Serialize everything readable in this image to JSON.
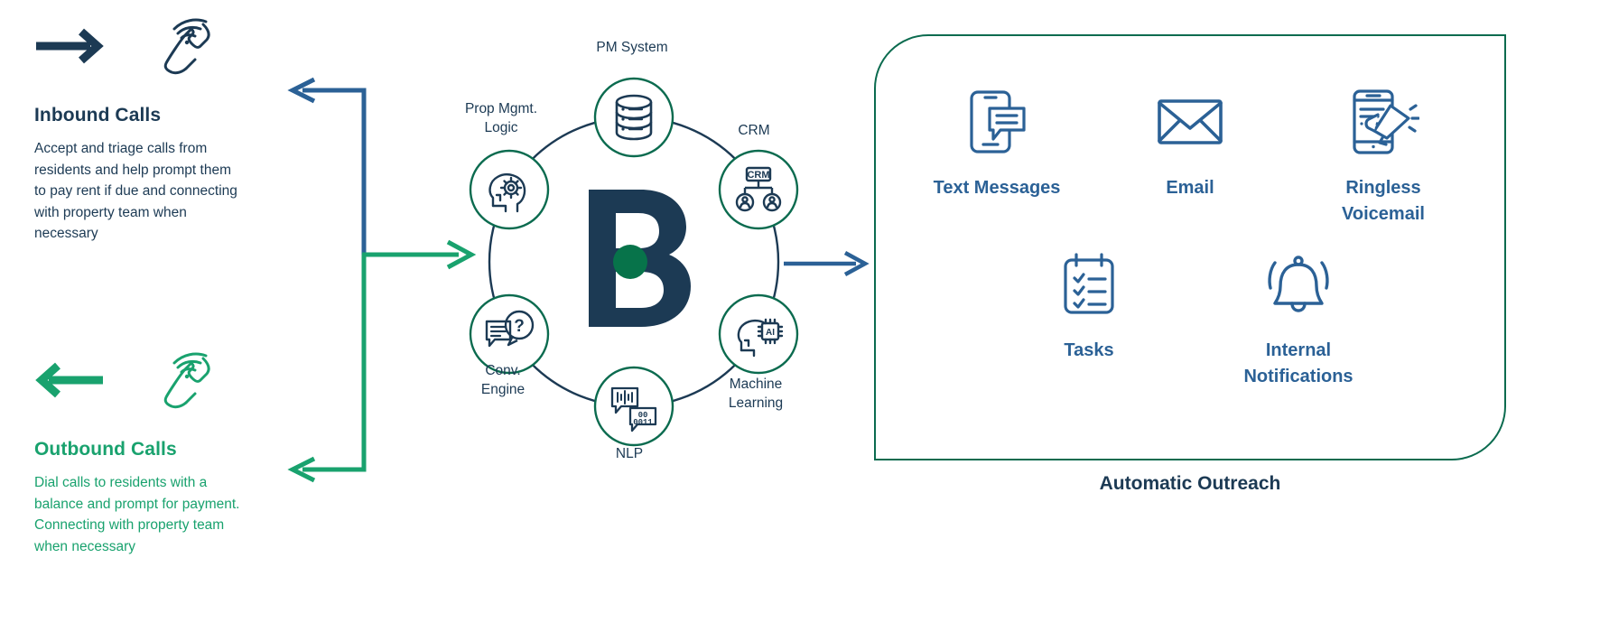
{
  "flows": [
    {
      "id": "inbound",
      "title": "Inbound Calls",
      "desc": "Accept and triage calls from residents and help prompt them to pay rent if due and connecting with property team when necessary",
      "color": "#1c3a54",
      "arrow_icon": "arrow-right-icon",
      "phone_icon": "phone-ringing-icon"
    },
    {
      "id": "outbound",
      "title": "Outbound Calls",
      "desc": "Dial calls to residents with a balance and prompt for payment. Connecting with property team when necessary",
      "color": "#19a26e",
      "arrow_icon": "arrow-left-icon",
      "phone_icon": "phone-ringing-icon"
    }
  ],
  "wheel": {
    "logo": "B",
    "logo_color": "#1c3a54",
    "logo_dot_color": "#07734a",
    "ring_color": "#1c3a54",
    "node_ring_color": "#0b6b4f",
    "nodes": [
      {
        "id": "pm-system",
        "label": "PM System",
        "icon": "database-icon"
      },
      {
        "id": "crm",
        "label": "CRM",
        "icon": "crm-org-chart-icon"
      },
      {
        "id": "ml",
        "label": "Machine\nLearning",
        "icon": "ai-head-chip-icon"
      },
      {
        "id": "nlp",
        "label": "NLP",
        "icon": "speech-binary-icon"
      },
      {
        "id": "conv-engine",
        "label": "Conv.\nEngine",
        "icon": "chat-question-icon"
      },
      {
        "id": "prop-logic",
        "label": "Prop Mgmt.\nLogic",
        "icon": "head-gear-icon"
      }
    ]
  },
  "connectors": {
    "inbound_color": "#2b6196",
    "outbound_color": "#19a26e",
    "mid_arrow_color": "#2b6196"
  },
  "outreach": {
    "caption": "Automatic Outreach",
    "border_color": "#0b6b4f",
    "label_color": "#2b6196",
    "rows": [
      [
        {
          "id": "text-messages",
          "label": "Text\nMessages",
          "icon": "phone-chat-icon"
        },
        {
          "id": "email",
          "label": "Email",
          "icon": "envelope-icon"
        },
        {
          "id": "ringless-vm",
          "label": "Ringless\nVoicemail",
          "icon": "phone-megaphone-icon"
        }
      ],
      [
        {
          "id": "tasks",
          "label": "Tasks",
          "icon": "checklist-icon"
        },
        {
          "id": "internal-notif",
          "label": "Internal\nNotifications",
          "icon": "bell-icon"
        }
      ]
    ]
  }
}
